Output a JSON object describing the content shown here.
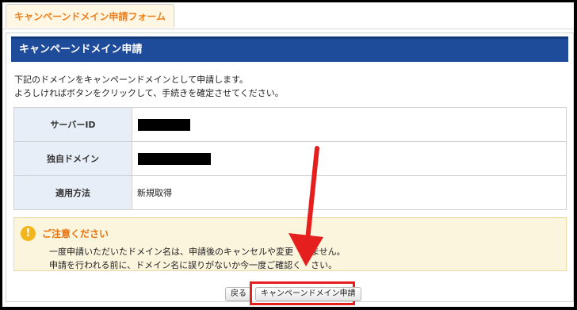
{
  "tab": {
    "label": "キャンペーンドメイン申請フォーム"
  },
  "section": {
    "title": "キャンペーンドメイン申請"
  },
  "intro": {
    "line1": "下記のドメインをキャンペーンドメインとして申請します。",
    "line2": "よろしければボタンをクリックして、手続きを確定させてください。"
  },
  "table": {
    "rows": [
      {
        "label": "サーバーID",
        "value": ""
      },
      {
        "label": "独自ドメイン",
        "value": ""
      },
      {
        "label": "適用方法",
        "value": "新規取得"
      }
    ]
  },
  "notice": {
    "title": "ご注意ください",
    "line1": "一度申請いただいたドメイン名は、申請後のキャンセルや変更",
    "line1_end": "ません。",
    "line2": "申請を行われる前に、ドメイン名に誤りがないか今一度ご確認く",
    "line2_end": "さい。"
  },
  "buttons": {
    "back": "戻る",
    "apply": "キャンペーンドメイン申請"
  },
  "colors": {
    "header": "#1f4c9a",
    "tab_text": "#ef7f1a",
    "annotation": "#e51e1e",
    "notice_bg": "#fcf5dd"
  },
  "icons": {
    "warning": "warning-icon"
  }
}
